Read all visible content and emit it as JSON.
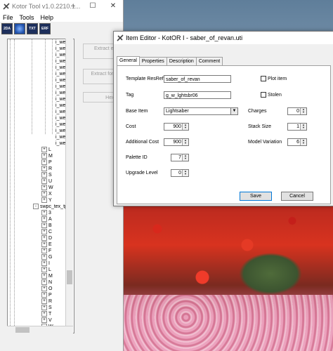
{
  "kotor_tool": {
    "title": "Kotor Tool v1.0.2210.1...",
    "menu": [
      "File",
      "Tools",
      "Help"
    ],
    "toolbar": [
      "2DA",
      "globe-icon",
      "TXT",
      "ERF"
    ],
    "tree_items_top": [
      "i_we...",
      "i_we...",
      "i_we...",
      "i_we...",
      "i_we...",
      "i_we...",
      "i_we...",
      "i_we...",
      "i_we...",
      "i_we...",
      "i_we...",
      "i_we...",
      "i_we...",
      "i_we...",
      "i_we...",
      "i_we...",
      "i_we..."
    ],
    "tree_letters_a": [
      "L",
      "M",
      "P",
      "R",
      "S",
      "U",
      "W",
      "X",
      "Y"
    ],
    "tree_folder": "swpc_tex_tp...",
    "tree_letters_b": [
      "3",
      "A",
      "B",
      "C",
      "D",
      "E",
      "F",
      "G",
      "I",
      "L",
      "M",
      "N",
      "O",
      "P",
      "R",
      "S",
      "T",
      "V",
      "W"
    ],
    "tree_last_child": "wsvb...",
    "side_buttons": [
      "Extract entire ERF file",
      "Extract for Module Editor",
      "Hex Viewer"
    ]
  },
  "dialog": {
    "title": "Item Editor - KotOR I - saber_of_revan.uti",
    "tabs": [
      "General",
      "Properties",
      "Description",
      "Comment"
    ],
    "active_tab": "General",
    "labels": {
      "template_resref": "Template ResRef",
      "tag": "Tag",
      "base_item": "Base Item",
      "cost": "Cost",
      "additional_cost": "Additional Cost",
      "palette_id": "Palette ID",
      "upgrade_level": "Upgrade Level",
      "plot_item": "Plot item",
      "stolen": "Stolen",
      "charges": "Charges",
      "stack_size": "Stack Size",
      "model_variation": "Model Variation"
    },
    "values": {
      "template_resref": "saber_of_revan",
      "tag": "g_w_lghtsbr06",
      "base_item": "Lightsaber",
      "cost": "900",
      "additional_cost": "900",
      "palette_id": "7",
      "upgrade_level": "0",
      "charges": "0",
      "stack_size": "1",
      "model_variation": "6",
      "plot_item": false,
      "stolen": false
    },
    "buttons": {
      "save": "Save",
      "cancel": "Cancel"
    }
  }
}
